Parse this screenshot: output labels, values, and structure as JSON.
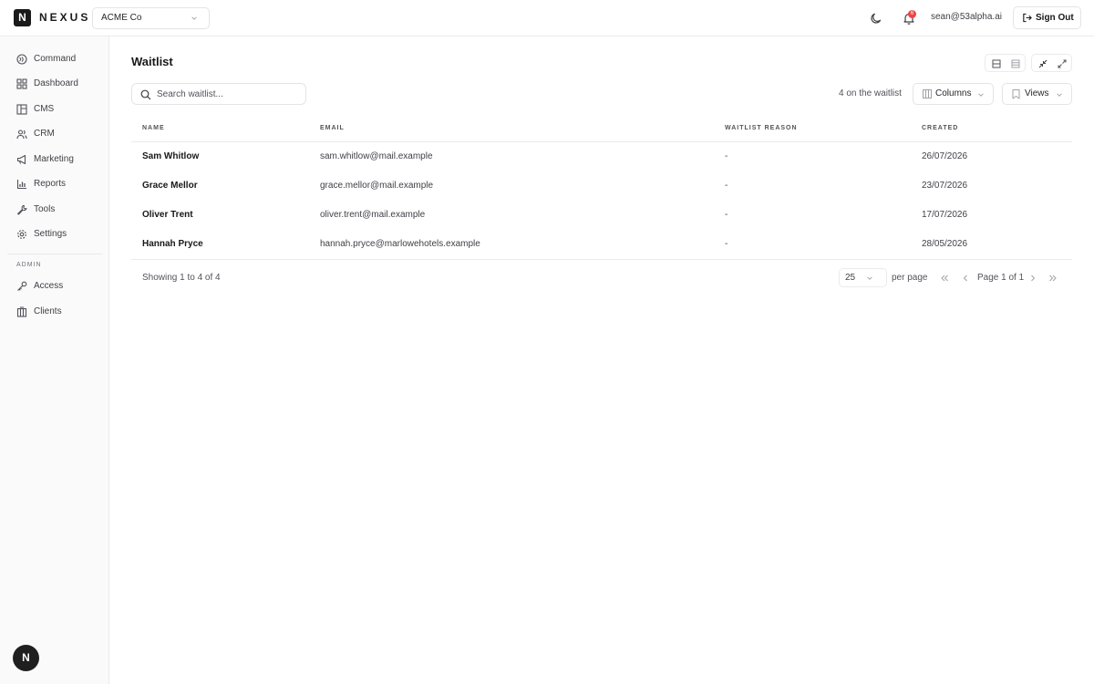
{
  "header": {
    "brand": "NEXUS",
    "brand_mark": "N",
    "org_select": "ACME Co",
    "notification_count": "6",
    "user_email": "sean@53alpha.ai",
    "sign_out_label": "Sign Out"
  },
  "sidebar": {
    "items": [
      {
        "label": "Command",
        "icon": "command-icon"
      },
      {
        "label": "Dashboard",
        "icon": "dashboard-icon"
      },
      {
        "label": "CMS",
        "icon": "cms-icon"
      },
      {
        "label": "CRM",
        "icon": "users-icon"
      },
      {
        "label": "Marketing",
        "icon": "megaphone-icon"
      },
      {
        "label": "Reports",
        "icon": "bar-chart-icon"
      },
      {
        "label": "Tools",
        "icon": "wrench-icon"
      },
      {
        "label": "Settings",
        "icon": "gear-icon"
      }
    ],
    "admin_label": "ADMIN",
    "admin_items": [
      {
        "label": "Access",
        "icon": "key-icon"
      },
      {
        "label": "Clients",
        "icon": "building-icon"
      }
    ],
    "fab_mark": "N"
  },
  "main": {
    "title": "Waitlist",
    "search_placeholder": "Search waitlist...",
    "count_text": "4 on the waitlist",
    "columns_label": "Columns",
    "views_label": "Views",
    "table": {
      "headers": [
        "NAME",
        "EMAIL",
        "WAITLIST REASON",
        "CREATED"
      ],
      "rows": [
        {
          "name": "Sam Whitlow",
          "email": "sam.whitlow@mail.example",
          "reason": "-",
          "created": "26/07/2026"
        },
        {
          "name": "Grace Mellor",
          "email": "grace.mellor@mail.example",
          "reason": "-",
          "created": "23/07/2026"
        },
        {
          "name": "Oliver Trent",
          "email": "oliver.trent@mail.example",
          "reason": "-",
          "created": "17/07/2026"
        },
        {
          "name": "Hannah Pryce",
          "email": "hannah.pryce@marlowehotels.example",
          "reason": "-",
          "created": "28/05/2026"
        }
      ]
    },
    "pagination": {
      "showing": "Showing 1 to 4 of 4",
      "per_page_value": "25",
      "per_page_label": "per page",
      "page_info": "Page 1 of 1"
    }
  },
  "colors": {
    "accent_dark": "#1a1a1a",
    "badge_red": "#ef4444",
    "border": "#ebebeb"
  }
}
